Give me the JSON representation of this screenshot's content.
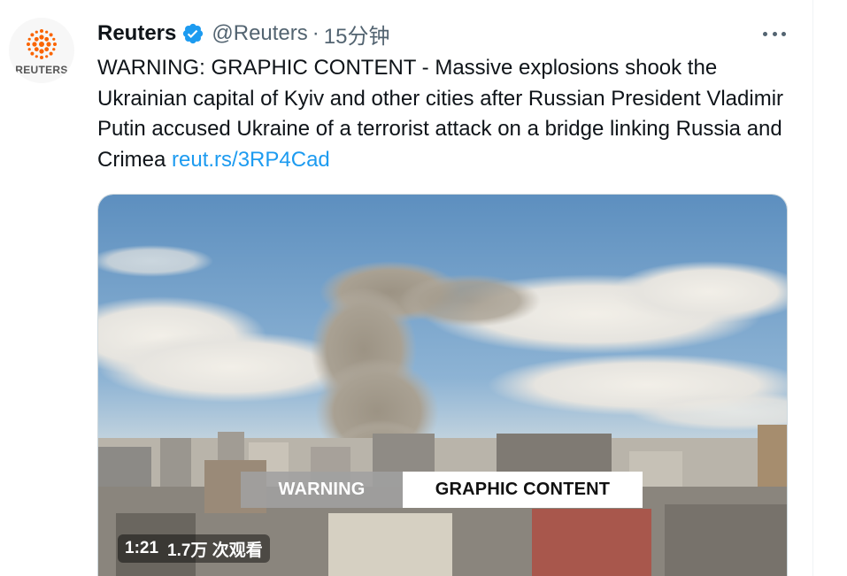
{
  "tweet": {
    "author_name": "Reuters",
    "handle": "@Reuters",
    "separator": "·",
    "time_ago": "15分钟",
    "text": "WARNING: GRAPHIC CONTENT - Massive explosions shook the Ukrainian capital of Kyiv and other cities after Russian President Vladimir Putin accused Ukraine of a terrorist attack on a bridge linking Russia and Crimea ",
    "link_text": "reut.rs/3RP4Cad"
  },
  "avatar": {
    "wordmark": "REUTERS",
    "icon": "reuters-logo-icon",
    "brand_color": "#fa6400"
  },
  "icons": {
    "verified": "verified-badge-icon",
    "more": "more-options-icon"
  },
  "video": {
    "warning_label": "WARNING",
    "content_label": "GRAPHIC CONTENT",
    "duration": "1:21",
    "views": "1.7万 次观看"
  },
  "colors": {
    "link": "#1d9bf0",
    "verified": "#1d9bf0",
    "muted_text": "#536471"
  }
}
